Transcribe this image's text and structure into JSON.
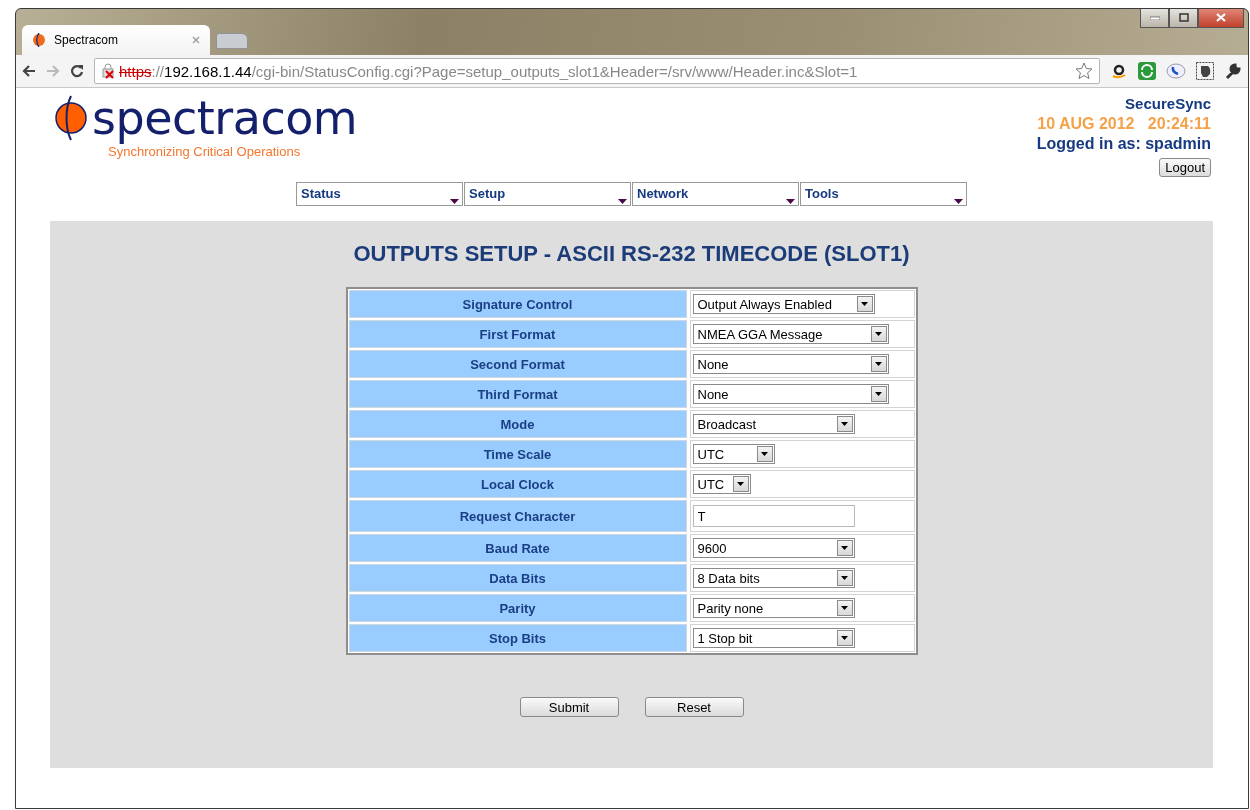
{
  "browser": {
    "tab_title": "Spectracom",
    "url": {
      "scheme": "https",
      "separator": "://",
      "host": "192.168.1.44",
      "path": "/cgi-bin/StatusConfig.cgi?Page=setup_outputs_slot1&Header=/srv/www/Header.inc&Slot=1"
    }
  },
  "header": {
    "logo": "spectracom",
    "tagline": "Synchronizing Critical Operations",
    "product": "SecureSync",
    "date": "10 AUG 2012",
    "time": "20:24:11",
    "login": "Logged in as: spadmin",
    "logout": "Logout"
  },
  "menu": [
    "Status",
    "Setup",
    "Network",
    "Tools"
  ],
  "title": "OUTPUTS SETUP - ASCII RS-232 TIMECODE (SLOT1)",
  "rows": [
    {
      "label": "Signature Control",
      "kind": "select",
      "value": "Output Always Enabled"
    },
    {
      "label": "First Format",
      "kind": "select",
      "value": "NMEA GGA Message"
    },
    {
      "label": "Second Format",
      "kind": "select",
      "value": "None"
    },
    {
      "label": "Third Format",
      "kind": "select",
      "value": "None"
    },
    {
      "label": "Mode",
      "kind": "select",
      "value": "Broadcast"
    },
    {
      "label": "Time Scale",
      "kind": "select",
      "value": "UTC"
    },
    {
      "label": "Local Clock",
      "kind": "select",
      "value": "UTC"
    },
    {
      "label": "Request Character",
      "kind": "text",
      "value": "T"
    },
    {
      "label": "Baud Rate",
      "kind": "select",
      "value": "9600"
    },
    {
      "label": "Data Bits",
      "kind": "select",
      "value": "8 Data bits"
    },
    {
      "label": "Parity",
      "kind": "select",
      "value": "Parity none"
    },
    {
      "label": "Stop Bits",
      "kind": "select",
      "value": "1 Stop bit"
    }
  ],
  "buttons": [
    "Submit",
    "Reset"
  ]
}
